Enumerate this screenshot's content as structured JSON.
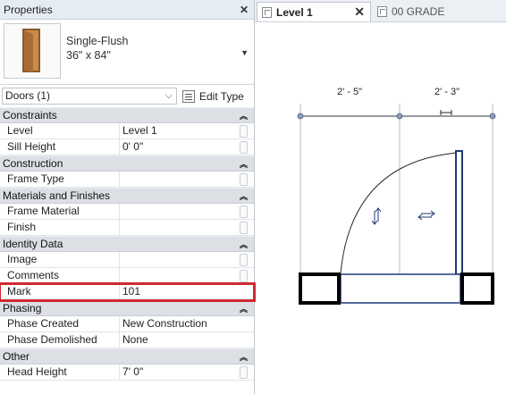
{
  "properties": {
    "title": "Properties",
    "type_name_line1": "Single-Flush",
    "type_name_line2": "36\" x 84\"",
    "instance_selector": "Doors (1)",
    "edit_type_label": "Edit Type",
    "groups": {
      "constraints": "Constraints",
      "construction": "Construction",
      "materials": "Materials and Finishes",
      "identity": "Identity Data",
      "phasing": "Phasing",
      "other": "Other"
    },
    "rows": {
      "level": {
        "name": "Level",
        "value": "Level 1"
      },
      "sill_height": {
        "name": "Sill Height",
        "value": "0'  0\""
      },
      "frame_type": {
        "name": "Frame Type",
        "value": ""
      },
      "frame_material": {
        "name": "Frame Material",
        "value": ""
      },
      "finish": {
        "name": "Finish",
        "value": ""
      },
      "image": {
        "name": "Image",
        "value": ""
      },
      "comments": {
        "name": "Comments",
        "value": ""
      },
      "mark": {
        "name": "Mark",
        "value": "101"
      },
      "phase_created": {
        "name": "Phase Created",
        "value": "New Construction"
      },
      "phase_demolished": {
        "name": "Phase Demolished",
        "value": "None"
      },
      "head_height": {
        "name": "Head Height",
        "value": "7'  0\""
      }
    }
  },
  "view": {
    "tabs": [
      {
        "label": "Level 1",
        "active": true
      },
      {
        "label": "00 GRADE",
        "active": false
      }
    ],
    "dimensions": {
      "left": "2' - 5\"",
      "right": "2' - 3\""
    },
    "highlight_color": "#cc2a35",
    "door_color": "#1f3a7a"
  }
}
